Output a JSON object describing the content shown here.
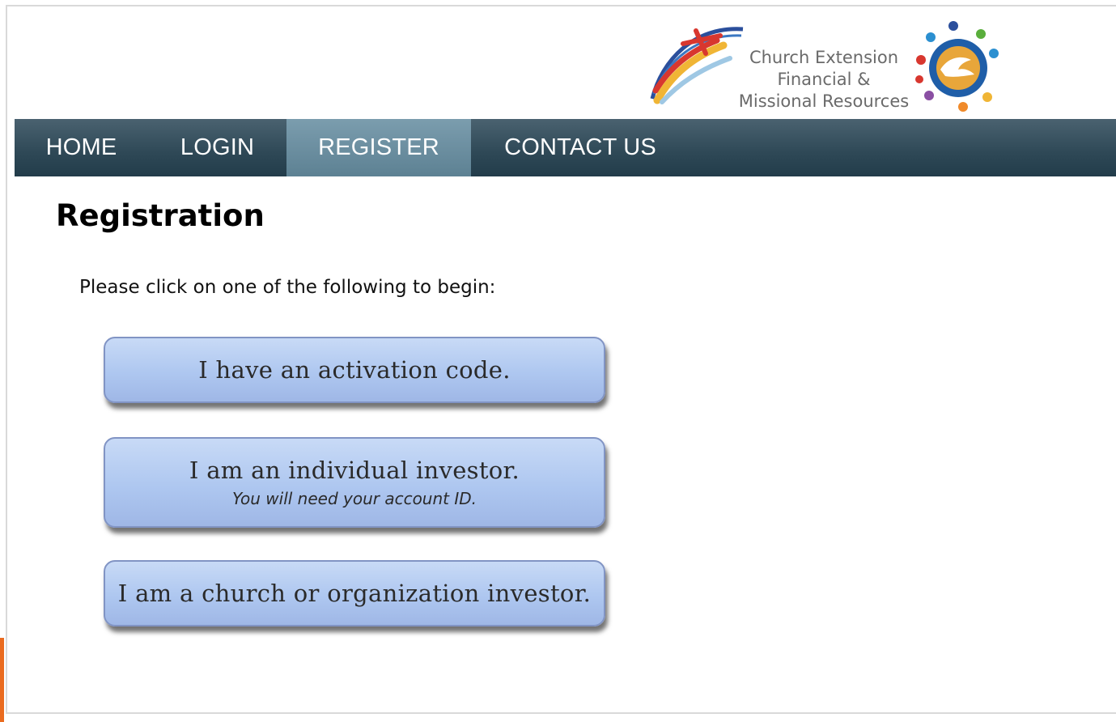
{
  "logo": {
    "lines": [
      "Church Extension",
      "Financial &",
      "Missional Resources"
    ]
  },
  "nav": {
    "items": [
      {
        "label": "HOME"
      },
      {
        "label": "LOGIN"
      },
      {
        "label": "REGISTER",
        "active": true
      },
      {
        "label": "CONTACT US"
      }
    ]
  },
  "main": {
    "title": "Registration",
    "instructions": "Please click on one of the following to begin:",
    "options": [
      {
        "label": "I have an activation code."
      },
      {
        "label": "I am an individual investor.",
        "sublabel": "You will need your account ID."
      },
      {
        "label": "I am a church or organization investor."
      }
    ]
  },
  "colors": {
    "nav_bg": "#2e4856",
    "nav_active": "#6a8ea0",
    "button_fill": "#aec7f0",
    "button_border": "#8194c4",
    "accent_orange": "#ea6b1f"
  }
}
